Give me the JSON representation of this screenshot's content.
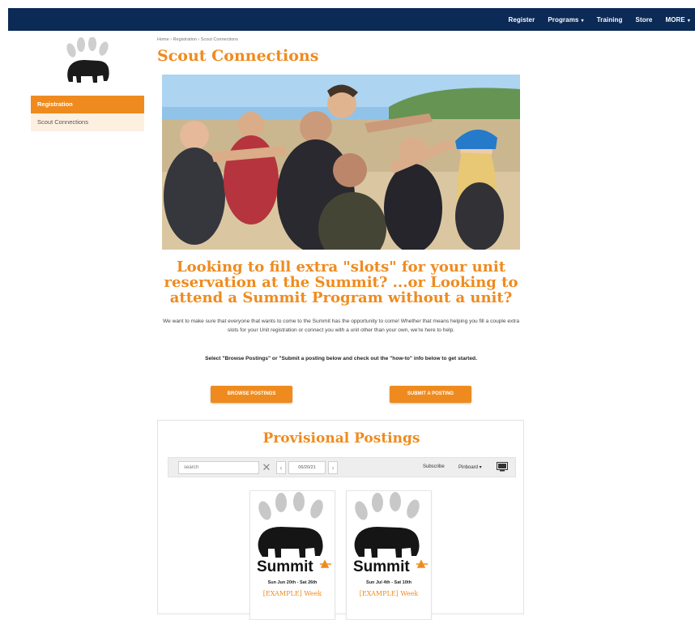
{
  "nav": {
    "items": [
      {
        "label": "Register"
      },
      {
        "label": "Programs",
        "caret": "▾"
      },
      {
        "label": "Training"
      },
      {
        "label": "Store"
      },
      {
        "label": "MORE",
        "caret": "▾"
      }
    ]
  },
  "sidebar": {
    "items": [
      {
        "label": "Registration"
      },
      {
        "label": "Scout Connections"
      }
    ]
  },
  "breadcrumb": "Home › Registration › Scout Connections",
  "page": {
    "title": "Scout Connections",
    "heading": "Looking to fill extra \"slots\" for your unit reservation at the Summit? ...or Looking to attend a Summit Program without a unit?",
    "intro": "We want to make sure that everyone that wants to come to the Summit has the opportunity to come! Whether that means helping you fill a couple extra slots for your Unit registration or connect you with a unit other than your own, we're here to help.",
    "instruction": "Select \"Browse Postings\" or \"Submit a posting below and check out the \"how-to\" info below to get started.",
    "browse_label": "BROWSE POSTINGS",
    "submit_label": "SUBMIT A POSTING"
  },
  "postings": {
    "title": "Provisional Postings",
    "search_placeholder": "search",
    "clear_glyph": "✕",
    "prev_glyph": "‹",
    "next_glyph": "›",
    "date": "06/20/21",
    "subscribe": "Subscribe",
    "pinboard": "Pinboard ▾",
    "cards": [
      {
        "date": "Sun Jun 20th - Sat 26th",
        "title": "[EXAMPLE] Week",
        "logo_text": "Summit"
      },
      {
        "date": "Sun Jul 4th - Sat 10th",
        "title": "[EXAMPLE] Week",
        "logo_text": "Summit"
      }
    ]
  },
  "colors": {
    "nav_bg": "#0b2a55",
    "accent": "#ef8b1e",
    "sidebar_sub_bg": "#fdf0e1"
  },
  "icons": {
    "logo": "bear-paw-logo",
    "clear": "close-icon",
    "prev": "chevron-left-icon",
    "next": "chevron-right-icon",
    "screen": "monitor-icon"
  }
}
